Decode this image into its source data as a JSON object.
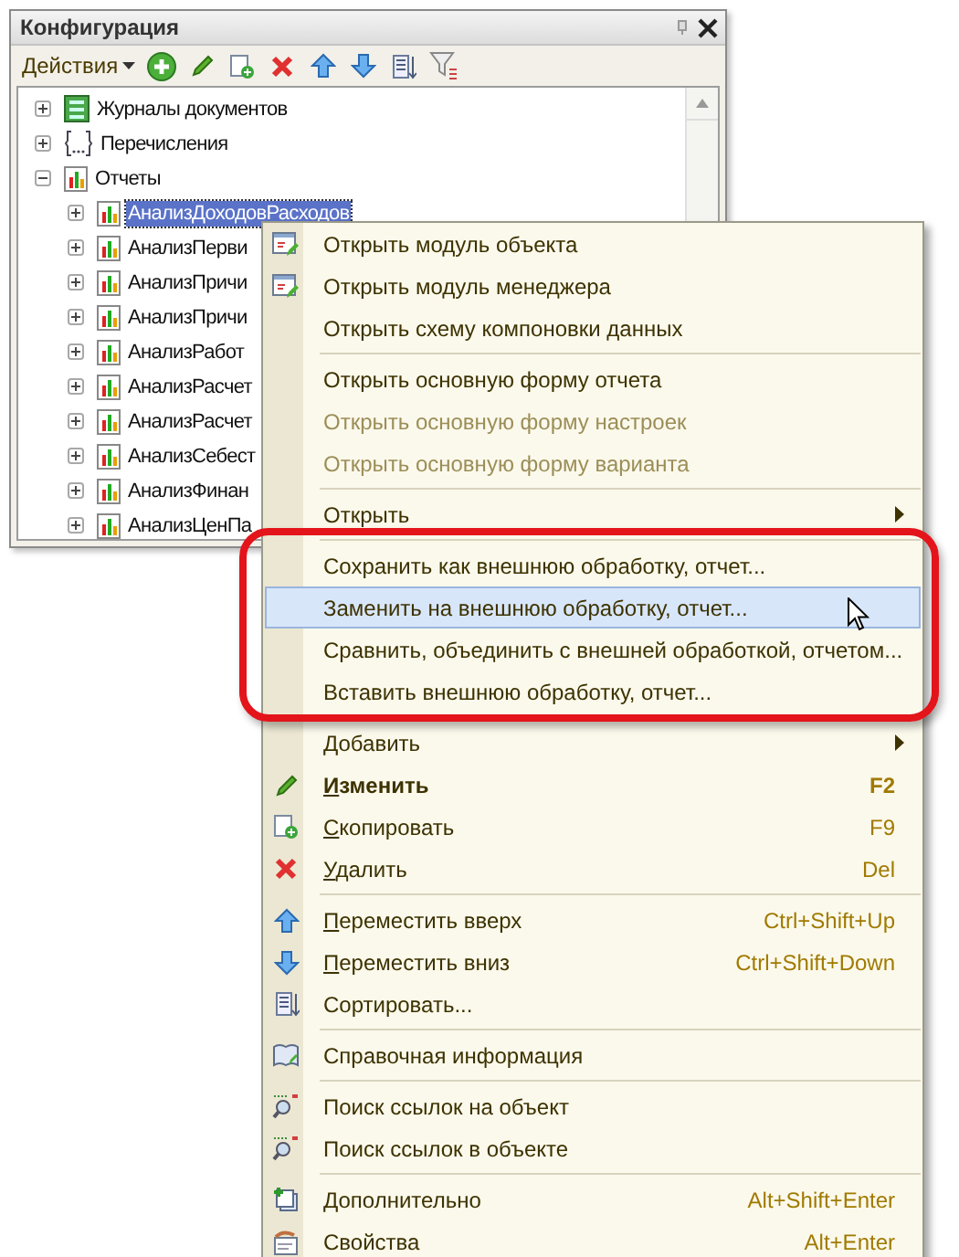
{
  "window": {
    "title": "Конфигурация"
  },
  "toolbar": {
    "actions_label": "Действия"
  },
  "tree": [
    {
      "label": "Журналы документов",
      "expanded": false,
      "selected": false
    },
    {
      "label": "Перечисления",
      "expanded": false,
      "selected": false
    },
    {
      "label": "Отчеты",
      "expanded": true,
      "selected": false,
      "children": [
        {
          "label": "АнализДоходовРасходов",
          "expanded": false,
          "selected": true
        },
        {
          "label": "АнализПерви",
          "expanded": false,
          "selected": false
        },
        {
          "label": "АнализПричи",
          "expanded": false,
          "selected": false
        },
        {
          "label": "АнализПричи",
          "expanded": false,
          "selected": false
        },
        {
          "label": "АнализРабот",
          "expanded": false,
          "selected": false
        },
        {
          "label": "АнализРасчет",
          "expanded": false,
          "selected": false
        },
        {
          "label": "АнализРасчет",
          "expanded": false,
          "selected": false
        },
        {
          "label": "АнализСебест",
          "expanded": false,
          "selected": false
        },
        {
          "label": "АнализФинан",
          "expanded": false,
          "selected": false
        },
        {
          "label": "АнализЦенПа",
          "expanded": false,
          "selected": false
        }
      ]
    }
  ],
  "context_menu": [
    {
      "kind": "item",
      "label": "Открыть модуль объекта",
      "disabled": false,
      "selected": false,
      "bold": false,
      "mnemonic": false,
      "submenu": false
    },
    {
      "kind": "item",
      "label": "Открыть модуль менеджера",
      "disabled": false,
      "selected": false,
      "bold": false,
      "mnemonic": false,
      "submenu": false
    },
    {
      "kind": "item",
      "label": "Открыть схему компоновки данных",
      "disabled": false,
      "selected": false,
      "bold": false,
      "mnemonic": false,
      "submenu": false
    },
    {
      "kind": "separator"
    },
    {
      "kind": "item",
      "label": "Открыть основную форму отчета",
      "disabled": false,
      "selected": false,
      "bold": false,
      "mnemonic": false,
      "submenu": false
    },
    {
      "kind": "item",
      "label": "Открыть основную форму настроек",
      "disabled": true,
      "selected": false,
      "bold": false,
      "mnemonic": false,
      "submenu": false
    },
    {
      "kind": "item",
      "label": "Открыть основную форму варианта",
      "disabled": true,
      "selected": false,
      "bold": false,
      "mnemonic": false,
      "submenu": false
    },
    {
      "kind": "separator"
    },
    {
      "kind": "item",
      "label": "Открыть",
      "disabled": false,
      "selected": false,
      "bold": false,
      "mnemonic": false,
      "submenu": true
    },
    {
      "kind": "separator"
    },
    {
      "kind": "item",
      "label": "Сохранить как внешнюю обработку, отчет...",
      "disabled": false,
      "selected": false,
      "bold": false,
      "mnemonic": false,
      "submenu": false
    },
    {
      "kind": "item",
      "label": "Заменить на внешнюю обработку, отчет...",
      "disabled": false,
      "selected": true,
      "bold": false,
      "mnemonic": false,
      "submenu": false
    },
    {
      "kind": "item",
      "label": "Сравнить, объединить с внешней обработкой, отчетом...",
      "disabled": false,
      "selected": false,
      "bold": false,
      "mnemonic": false,
      "submenu": false
    },
    {
      "kind": "item",
      "label": "Вставить внешнюю обработку, отчет...",
      "disabled": false,
      "selected": false,
      "bold": false,
      "mnemonic": false,
      "submenu": false
    },
    {
      "kind": "separator"
    },
    {
      "kind": "item",
      "label": "Добавить",
      "disabled": false,
      "selected": false,
      "bold": false,
      "mnemonic": false,
      "submenu": true
    },
    {
      "kind": "item",
      "label": "Изменить",
      "shortcut": "F2",
      "disabled": false,
      "selected": false,
      "bold": true,
      "mnemonic": true,
      "submenu": false
    },
    {
      "kind": "item",
      "label": "Скопировать",
      "shortcut": "F9",
      "disabled": false,
      "selected": false,
      "bold": false,
      "mnemonic": true,
      "submenu": false
    },
    {
      "kind": "item",
      "label": "Удалить",
      "shortcut": "Del",
      "disabled": false,
      "selected": false,
      "bold": false,
      "mnemonic": true,
      "submenu": false
    },
    {
      "kind": "separator"
    },
    {
      "kind": "item",
      "label": "Переместить вверх",
      "shortcut": "Ctrl+Shift+Up",
      "disabled": false,
      "selected": false,
      "bold": false,
      "mnemonic": true,
      "submenu": false
    },
    {
      "kind": "item",
      "label": "Переместить вниз",
      "shortcut": "Ctrl+Shift+Down",
      "disabled": false,
      "selected": false,
      "bold": false,
      "mnemonic": true,
      "submenu": false
    },
    {
      "kind": "item",
      "label": "Сортировать...",
      "disabled": false,
      "selected": false,
      "bold": false,
      "mnemonic": false,
      "submenu": false
    },
    {
      "kind": "separator"
    },
    {
      "kind": "item",
      "label": "Справочная информация",
      "disabled": false,
      "selected": false,
      "bold": false,
      "mnemonic": false,
      "submenu": false
    },
    {
      "kind": "separator"
    },
    {
      "kind": "item",
      "label": "Поиск ссылок на объект",
      "disabled": false,
      "selected": false,
      "bold": false,
      "mnemonic": false,
      "submenu": false
    },
    {
      "kind": "item",
      "label": "Поиск ссылок в объекте",
      "disabled": false,
      "selected": false,
      "bold": false,
      "mnemonic": false,
      "submenu": false
    },
    {
      "kind": "separator"
    },
    {
      "kind": "item",
      "label": "Дополнительно",
      "shortcut": "Alt+Shift+Enter",
      "disabled": false,
      "selected": false,
      "bold": false,
      "mnemonic": false,
      "submenu": false
    },
    {
      "kind": "item",
      "label": "Свойства",
      "shortcut": "Alt+Enter",
      "disabled": false,
      "selected": false,
      "bold": false,
      "mnemonic": false,
      "submenu": false
    }
  ]
}
